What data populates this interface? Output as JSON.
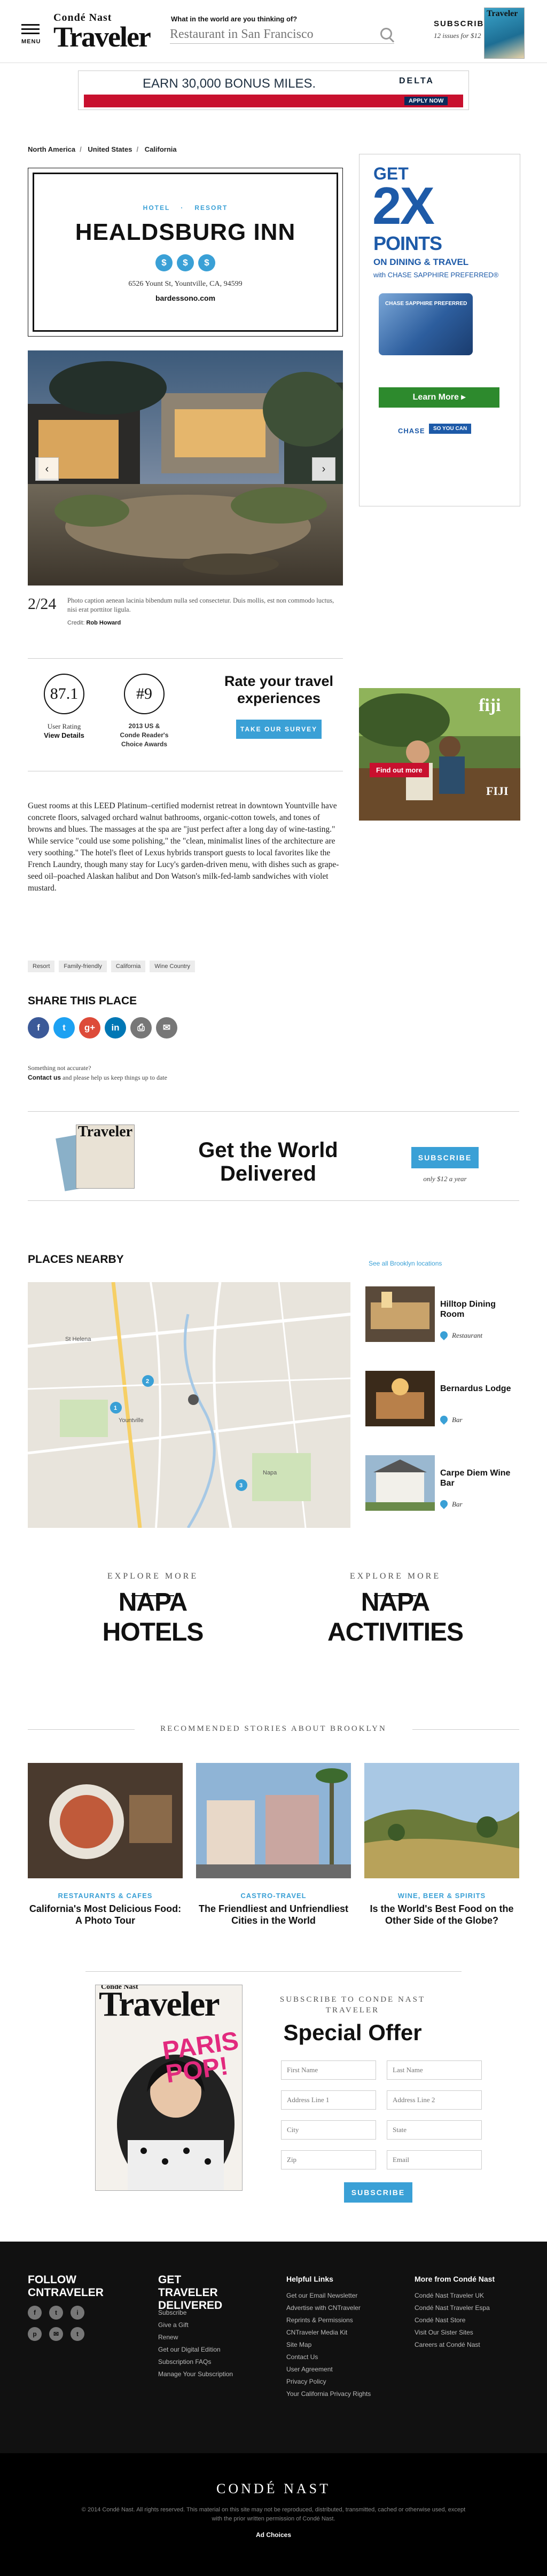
{
  "header": {
    "menu_label": "MENU",
    "logo_top": "Condé Nast",
    "logo_main": "Traveler",
    "search_label": "What in the world are you thinking of?",
    "search_placeholder": "Restaurant in San Francisco",
    "subscribe_label": "SUBSCRIBE",
    "subscribe_price": "12 issues for $12"
  },
  "banner_ad": {
    "text": "EARN 30,000 BONUS MILES.",
    "brand": "DELTA",
    "apply": "APPLY NOW"
  },
  "breadcrumb": [
    "North America",
    "United States",
    "California"
  ],
  "hotel": {
    "tags": [
      "HOTEL",
      "RESORT"
    ],
    "name": "HEALDSBURG INN",
    "prices": [
      "$",
      "$",
      "$"
    ],
    "address": "6526 Yount St, Yountville, CA, 94599",
    "website": "bardessono.com"
  },
  "gallery": {
    "counter": "2/24",
    "caption": "Photo caption aenean lacinia bibendum nulla sed consectetur. Duis mollis, est non commodo luctus, nisi erat porttitor ligula.",
    "credit_label": "Credit:",
    "credit_name": "Rob Howard",
    "prev": "‹",
    "next": "›"
  },
  "ratings": {
    "user_score": "87.1",
    "user_label": "User Rating",
    "user_link": "View Details",
    "award_rank": "#9",
    "award_line1": "2013 US &",
    "award_line2": "Conde Reader's",
    "award_line3": "Choice Awards",
    "cta_heading": "Rate your travel experiences",
    "cta_button": "TAKE OUR SURVEY"
  },
  "description": "Guest rooms at this LEED Platinum–certified modernist retreat in downtown Yountville have concrete floors, salvaged orchard walnut bathrooms, organic-cotton towels, and tones of browns and blues. The massages at the spa are \"just perfect after a long day of wine-tasting.\" While service \"could use some polishing,\" the \"clean, minimalist lines of the architecture are very soothing.\" The hotel's fleet of Lexus hybrids transport guests to local favorites like the French Laundry, though many stay for Lucy's garden-driven menu, with dishes such as grape-seed oil–poached Alaskan halibut and Don Watson's milk-fed-lamb sandwiches with violet mustard.",
  "tags": [
    "Resort",
    "Family-friendly",
    "California",
    "Wine Country"
  ],
  "share": {
    "heading": "SHARE THIS PLACE",
    "buttons": [
      "f",
      "t",
      "g+",
      "in",
      "⎙",
      "✉"
    ]
  },
  "report": {
    "line1": "Something not accurate?",
    "contact": "Contact us",
    "line2": " and please help us keep things up to date"
  },
  "ad_chase": {
    "get": "GET",
    "big": "2X",
    "points": "POINTS",
    "line": "ON DINING & TRAVEL",
    "sub": "with CHASE SAPPHIRE PREFERRED®",
    "card": "CHASE SAPPHIRE PREFERRED",
    "learn": "Learn More ▸",
    "brand": "CHASE",
    "go": "SO YOU CAN"
  },
  "ad_fiji": {
    "logo": "fiji",
    "cta": "Find out more",
    "logo2": "FIJI"
  },
  "subscribe_strip": {
    "heading": "Get the World Delivered",
    "button": "SUBSCRIBE",
    "price": "only $12 a year",
    "mag_title": "Traveler"
  },
  "places": {
    "heading": "PLACES NEARBY",
    "see_all": "See all Brooklyn locations",
    "items": [
      {
        "name": "Hilltop Dining Room",
        "type": "Restaurant"
      },
      {
        "name": "Bernardus Lodge",
        "type": "Bar"
      },
      {
        "name": "Carpe Diem Wine Bar",
        "type": "Bar"
      }
    ],
    "map_labels": [
      "Yountville",
      "Napa",
      "St Helena"
    ],
    "map_pins": [
      "1",
      "2",
      "3"
    ]
  },
  "explore": {
    "label": "EXPLORE MORE",
    "items": [
      "NAPA HOTELS",
      "NAPA ACTIVITIES"
    ]
  },
  "recommended": {
    "heading": "RECOMMENDED STORIES ABOUT BROOKLYN",
    "items": [
      {
        "cat": "RESTAURANTS & CAFES",
        "title": "California's Most Delicious Food: A Photo Tour"
      },
      {
        "cat": "CASTRO-TRAVEL",
        "title": "The Friendliest and Unfriendliest Cities in the World"
      },
      {
        "cat": "WINE, BEER & SPIRITS",
        "title": "Is the World's Best Food on the Other Side of the Globe?"
      }
    ]
  },
  "offer": {
    "kicker": "SUBSCRIBE TO CONDE NAST TRAVELER",
    "heading": "Special Offer",
    "fields": [
      "First Name",
      "Last Name",
      "Address Line 1",
      "Address Line 2",
      "City",
      "State",
      "Zip",
      "Email"
    ],
    "button": "SUBSCRIBE",
    "mag_top": "Condé Nast",
    "mag_title": "Traveler",
    "mag_pop": "PARIS POP!"
  },
  "footer": {
    "follow": "FOLLOW CNTRAVELER",
    "social": [
      "f",
      "t",
      "p",
      "i",
      "✉",
      "t"
    ],
    "delivered": "GET TRAVELER DELIVERED",
    "delivered_links": [
      "Subscribe",
      "Give a Gift",
      "Renew",
      "Get our Digital Edition",
      "Subscription FAQs",
      "Manage Your Subscription"
    ],
    "helpful": "Helpful Links",
    "helpful_links": [
      "Get our Email Newsletter",
      "Advertise with CNTraveler",
      "Reprints & Permissions",
      "CNTraveler Media Kit",
      "Site Map",
      "Contact Us",
      "User Agreement",
      "Privacy Policy",
      "Your California Privacy Rights"
    ],
    "more": "More from Condé Nast",
    "more_links": [
      "Condé Nast Traveler UK",
      "Condé Nast Traveler Espa",
      "Condé Nast Store",
      "Visit Our Sister Sites",
      "Careers at Condé Nast"
    ],
    "brand": "CONDÉ NAST",
    "legal": "© 2014 Condé Nast. All rights reserved. This material on this site may not be reproduced, distributed, transmitted, cached or otherwise used, except with the prior written permission of Condé Nast.",
    "adchoices": "Ad Choices"
  },
  "colors": {
    "accent": "#3aa0d6",
    "footer": "#111111"
  }
}
